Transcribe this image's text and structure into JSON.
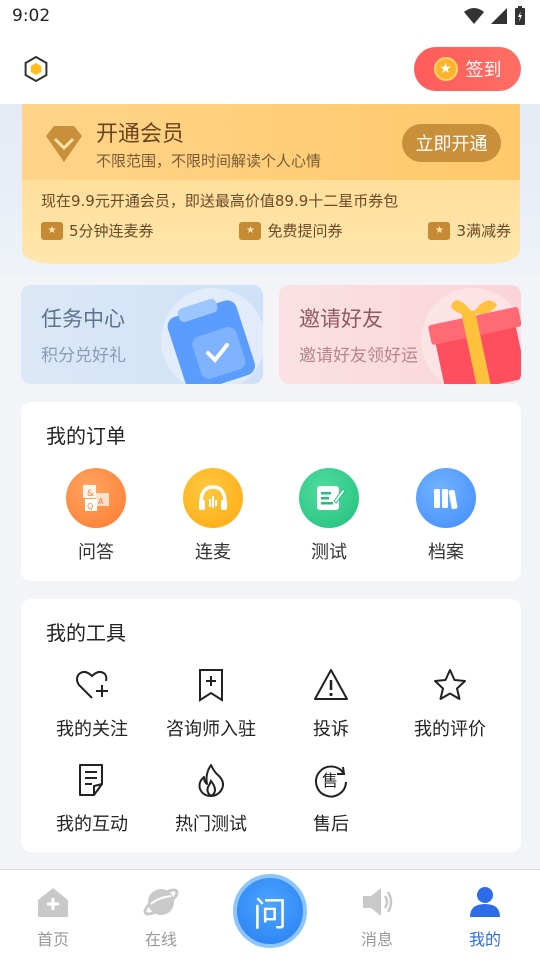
{
  "status_bar": {
    "time": "9:02"
  },
  "header": {
    "checkin_label": "签到"
  },
  "vip": {
    "title": "开通会员",
    "subtitle": "不限范围，不限时间解读个人心情",
    "open_button": "立即开通",
    "offer": "现在9.9元开通会员，即送最高价值89.9十二星币券包",
    "coupons": [
      {
        "label": "5分钟连麦券"
      },
      {
        "label": "免费提问券"
      },
      {
        "label": "3满减券"
      }
    ]
  },
  "promos": {
    "task": {
      "title": "任务中心",
      "subtitle": "积分兑好礼"
    },
    "invite": {
      "title": "邀请好友",
      "subtitle": "邀请好友领好运"
    }
  },
  "orders": {
    "title": "我的订单",
    "items": [
      {
        "label": "问答",
        "color": "#ff8a3d"
      },
      {
        "label": "连麦",
        "color": "#ffb21e"
      },
      {
        "label": "测试",
        "color": "#2fc98a"
      },
      {
        "label": "档案",
        "color": "#4b9bff"
      }
    ]
  },
  "tools": {
    "title": "我的工具",
    "items": [
      {
        "label": "我的关注",
        "icon": "heart-plus-icon"
      },
      {
        "label": "咨询师入驻",
        "icon": "bookmark-plus-icon"
      },
      {
        "label": "投诉",
        "icon": "warning-icon"
      },
      {
        "label": "我的评价",
        "icon": "star-icon"
      },
      {
        "label": "我的互动",
        "icon": "document-icon"
      },
      {
        "label": "热门测试",
        "icon": "flame-icon"
      },
      {
        "label": "售后",
        "icon": "after-sales-icon"
      }
    ]
  },
  "tabbar": {
    "center_label": "问",
    "tabs": [
      {
        "label": "首页"
      },
      {
        "label": "在线"
      },
      {
        "label": "消息"
      },
      {
        "label": "我的"
      }
    ],
    "active_color": "#2c6ce8"
  }
}
